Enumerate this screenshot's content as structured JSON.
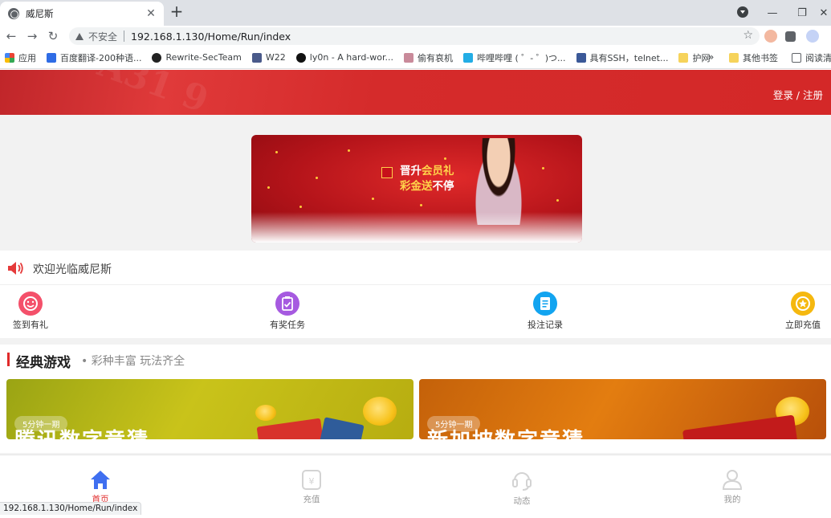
{
  "browser": {
    "tab_title": "威尼斯",
    "tab_close": "✕",
    "new_tab": "+",
    "window_controls": {
      "minimize": "—",
      "restore": "❐",
      "close": "✕"
    },
    "insecure_label": "不安全",
    "url": "192.168.1.130/Home/Run/index",
    "bookmarks": [
      {
        "label": "应用",
        "icon": "apps-grid-icon",
        "color": "#ea4335"
      },
      {
        "label": "百度翻译-200种语...",
        "icon": "translate-icon",
        "color": "#2f6ce5"
      },
      {
        "label": "Rewrite-SecTeam",
        "icon": "shield-icon",
        "color": "#222222"
      },
      {
        "label": "W22",
        "icon": "avatar-icon",
        "color": "#4a5a8a"
      },
      {
        "label": "ly0n - A hard-wor...",
        "icon": "github-icon",
        "color": "#111111"
      },
      {
        "label": "偷有哀机",
        "icon": "site-icon",
        "color": "#c98a9a"
      },
      {
        "label": "哔哩哔哩 ( ゜- ゜)つ...",
        "icon": "bilibili-icon",
        "color": "#23ade5"
      },
      {
        "label": "具有SSH，telnet...",
        "icon": "shield-icon",
        "color": "#3b5998"
      },
      {
        "label": "护网",
        "icon": "folder-icon",
        "color": "#f6d35b"
      }
    ],
    "bookmarks_more": "»",
    "other_bookmarks": "其他书签",
    "reading_list": "阅读清单",
    "status_url": "192.168.1.130/Home/Run/index"
  },
  "site": {
    "login_register": "登录 / 注册",
    "banner": {
      "line1_a": "晋升",
      "line1_b": "会员礼",
      "line2_a": "彩金送",
      "line2_b": "不停"
    },
    "notice": "欢迎光临威尼斯",
    "menu": [
      {
        "label": "签到有礼",
        "icon": "smile-icon",
        "color": "#f4506a"
      },
      {
        "label": "有奖任务",
        "icon": "task-icon",
        "color": "#a65ae0"
      },
      {
        "label": "投注记录",
        "icon": "record-icon",
        "color": "#12a4f0"
      },
      {
        "label": "立即充值",
        "icon": "recharge-star-icon",
        "color": "#f5b80f"
      }
    ],
    "section_title": "经典游戏",
    "section_subtitle": "• 彩种丰富 玩法齐全",
    "games": [
      {
        "badge": "5分钟一期",
        "name": "腾讯数字竞猜"
      },
      {
        "badge": "5分钟一期",
        "name": "新加坡数字竞猜"
      }
    ],
    "bottom_nav": [
      {
        "label": "首页",
        "icon": "home-icon",
        "active": true
      },
      {
        "label": "充值",
        "icon": "wallet-icon",
        "active": false
      },
      {
        "label": "动态",
        "icon": "headset-icon",
        "active": false
      },
      {
        "label": "我的",
        "icon": "user-icon",
        "active": false
      }
    ],
    "colors": {
      "brand_red": "#d42828",
      "active_blue": "#3f6ff0"
    }
  }
}
